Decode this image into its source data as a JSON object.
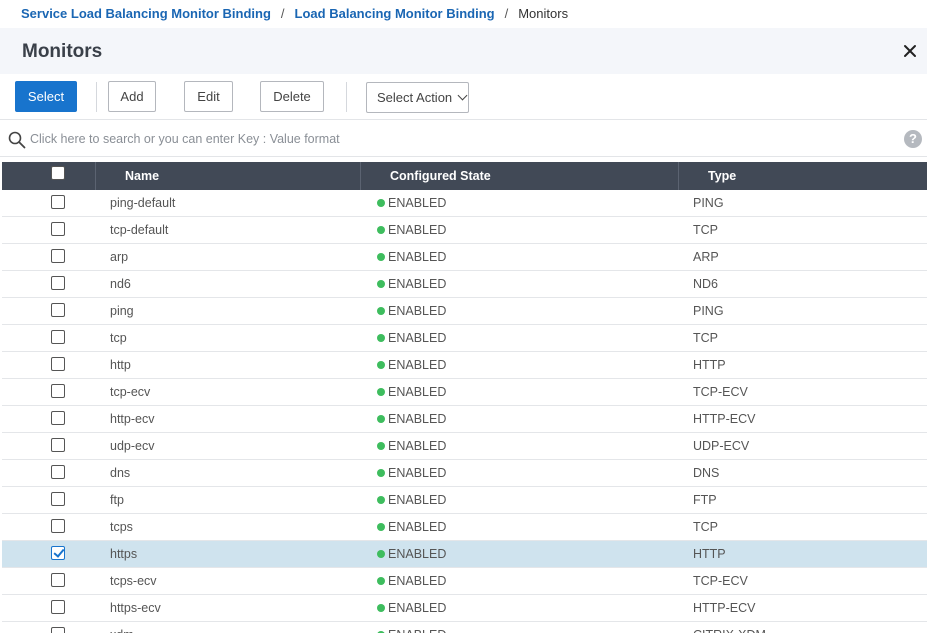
{
  "breadcrumb": {
    "items": [
      {
        "label": "Service Load Balancing Monitor Binding"
      },
      {
        "label": "Load Balancing Monitor Binding"
      }
    ],
    "separator": "/",
    "current": "Monitors"
  },
  "header": {
    "title": "Monitors",
    "close_icon": "close-icon"
  },
  "toolbar": {
    "select_label": "Select",
    "add_label": "Add",
    "edit_label": "Edit",
    "delete_label": "Delete",
    "action_label": "Select Action"
  },
  "search": {
    "placeholder": "Click here to search or you can enter Key : Value format",
    "value": "",
    "help_glyph": "?"
  },
  "colors": {
    "accent": "#1874cd",
    "header_bg": "#414956",
    "enabled": "#3ebd5e",
    "selected_row": "#cfe3ee"
  },
  "table": {
    "columns": [
      "Name",
      "Configured State",
      "Type"
    ],
    "header_checked": false,
    "rows": [
      {
        "name": "ping-default",
        "state": "ENABLED",
        "type": "PING",
        "checked": false
      },
      {
        "name": "tcp-default",
        "state": "ENABLED",
        "type": "TCP",
        "checked": false
      },
      {
        "name": "arp",
        "state": "ENABLED",
        "type": "ARP",
        "checked": false
      },
      {
        "name": "nd6",
        "state": "ENABLED",
        "type": "ND6",
        "checked": false
      },
      {
        "name": "ping",
        "state": "ENABLED",
        "type": "PING",
        "checked": false
      },
      {
        "name": "tcp",
        "state": "ENABLED",
        "type": "TCP",
        "checked": false
      },
      {
        "name": "http",
        "state": "ENABLED",
        "type": "HTTP",
        "checked": false
      },
      {
        "name": "tcp-ecv",
        "state": "ENABLED",
        "type": "TCP-ECV",
        "checked": false
      },
      {
        "name": "http-ecv",
        "state": "ENABLED",
        "type": "HTTP-ECV",
        "checked": false
      },
      {
        "name": "udp-ecv",
        "state": "ENABLED",
        "type": "UDP-ECV",
        "checked": false
      },
      {
        "name": "dns",
        "state": "ENABLED",
        "type": "DNS",
        "checked": false
      },
      {
        "name": "ftp",
        "state": "ENABLED",
        "type": "FTP",
        "checked": false
      },
      {
        "name": "tcps",
        "state": "ENABLED",
        "type": "TCP",
        "checked": false
      },
      {
        "name": "https",
        "state": "ENABLED",
        "type": "HTTP",
        "checked": true
      },
      {
        "name": "tcps-ecv",
        "state": "ENABLED",
        "type": "TCP-ECV",
        "checked": false
      },
      {
        "name": "https-ecv",
        "state": "ENABLED",
        "type": "HTTP-ECV",
        "checked": false
      },
      {
        "name": "xdm",
        "state": "ENABLED",
        "type": "CITRIX-XDM",
        "checked": false
      }
    ]
  }
}
